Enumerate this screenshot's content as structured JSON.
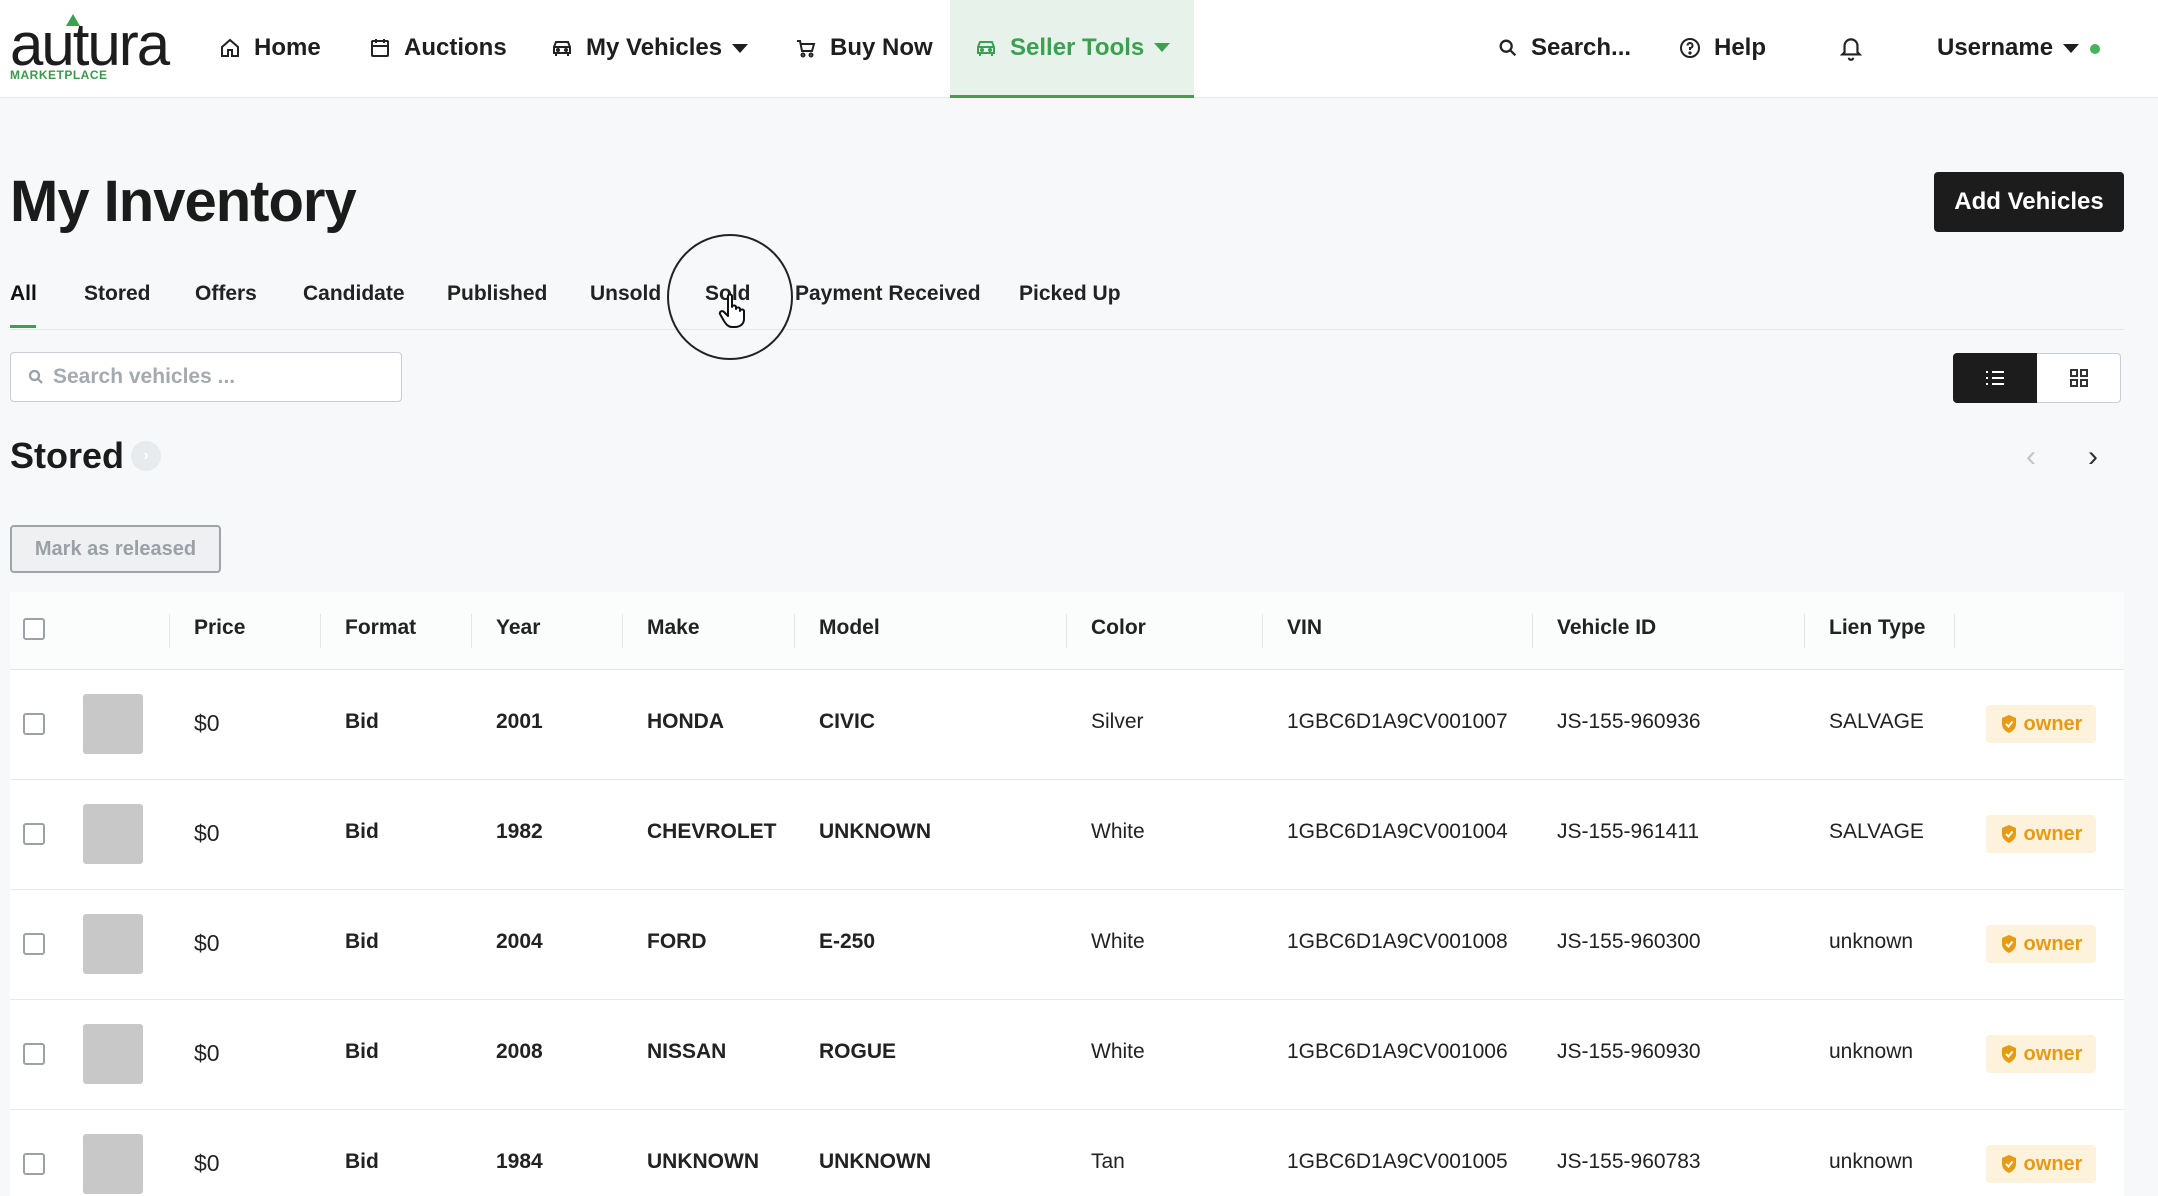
{
  "brand": {
    "name": "autura",
    "sub": "MARKETPLACE",
    "accent": "#3ba052"
  },
  "nav": {
    "home": "Home",
    "auctions": "Auctions",
    "my_vehicles": "My Vehicles",
    "buy_now": "Buy Now",
    "seller_tools": "Seller Tools",
    "search": "Search...",
    "help": "Help",
    "username": "Username"
  },
  "page": {
    "title": "My Inventory",
    "add_button": "Add Vehicles"
  },
  "tabs": [
    "All",
    "Stored",
    "Offers",
    "Candidate",
    "Published",
    "Unsold",
    "Sold",
    "Payment Received",
    "Picked Up"
  ],
  "active_tab": "All",
  "search": {
    "placeholder": "Search vehicles ..."
  },
  "section": {
    "title": "Stored",
    "release_button": "Mark as released"
  },
  "table": {
    "columns": [
      "Price",
      "Format",
      "Year",
      "Make",
      "Model",
      "Color",
      "VIN",
      "Vehicle ID",
      "Lien Type"
    ],
    "rows": [
      {
        "price": "$0",
        "format": "Bid",
        "year": "2001",
        "make": "HONDA",
        "model": "CIVIC",
        "color": "Silver",
        "vin": "1GBC6D1A9CV001007",
        "vehicle_id": "JS-155-960936",
        "lien": "SALVAGE",
        "badge": "owner"
      },
      {
        "price": "$0",
        "format": "Bid",
        "year": "1982",
        "make": "CHEVROLET",
        "model": "UNKNOWN",
        "color": "White",
        "vin": "1GBC6D1A9CV001004",
        "vehicle_id": "JS-155-961411",
        "lien": "SALVAGE",
        "badge": "owner"
      },
      {
        "price": "$0",
        "format": "Bid",
        "year": "2004",
        "make": "FORD",
        "model": "E-250",
        "color": "White",
        "vin": "1GBC6D1A9CV001008",
        "vehicle_id": "JS-155-960300",
        "lien": "unknown",
        "badge": "owner"
      },
      {
        "price": "$0",
        "format": "Bid",
        "year": "2008",
        "make": "NISSAN",
        "model": "ROGUE",
        "color": "White",
        "vin": "1GBC6D1A9CV001006",
        "vehicle_id": "JS-155-960930",
        "lien": "unknown",
        "badge": "owner"
      },
      {
        "price": "$0",
        "format": "Bid",
        "year": "1984",
        "make": "UNKNOWN",
        "model": "UNKNOWN",
        "color": "Tan",
        "vin": "1GBC6D1A9CV001005",
        "vehicle_id": "JS-155-960783",
        "lien": "unknown",
        "badge": "owner"
      }
    ]
  }
}
